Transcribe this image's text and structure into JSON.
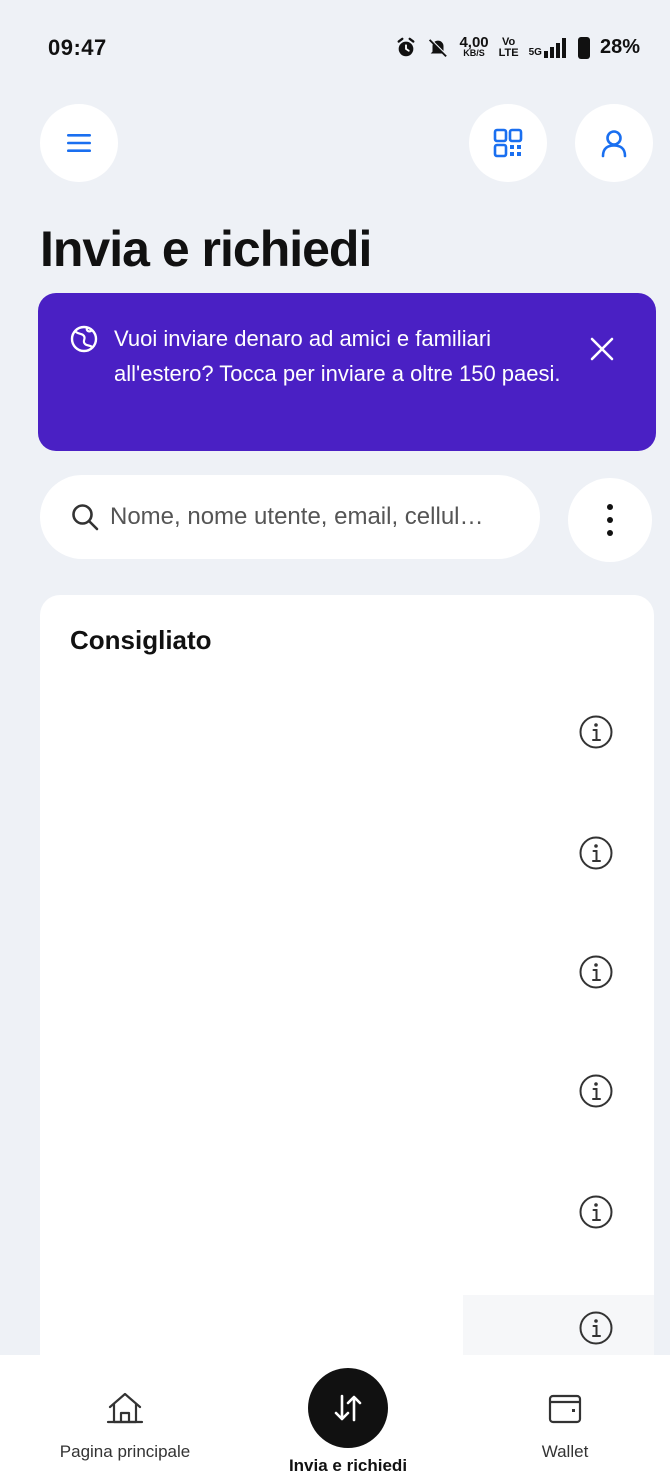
{
  "status_bar": {
    "time": "09:47",
    "net_speed_value": "4,00",
    "net_speed_unit": "KB/S",
    "volte_top": "Vo",
    "volte_bottom": "LTE",
    "network": "5G",
    "battery": "28%"
  },
  "header": {
    "menu_icon": "hamburger-icon",
    "qr_icon": "qr-code-icon",
    "profile_icon": "user-icon"
  },
  "page": {
    "title": "Invia e richiedi"
  },
  "banner": {
    "text": "Vuoi inviare denaro ad amici e familiari all'estero? Tocca per inviare a oltre 150 paesi.",
    "background": "#4a20c4"
  },
  "search": {
    "placeholder": "Nome, nome utente, email, cellul…"
  },
  "recommended": {
    "title": "Consigliato",
    "rows": 6
  },
  "bottom_nav": {
    "home_label": "Pagina principale",
    "send_label": "Invia e richiedi",
    "wallet_label": "Wallet"
  },
  "colors": {
    "accent": "#1a6ff0",
    "background": "#eef1f6"
  }
}
